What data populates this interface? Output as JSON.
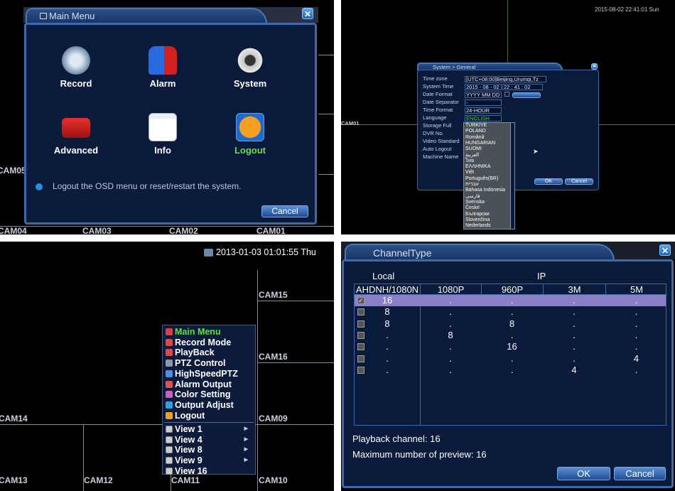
{
  "main_menu_screen": {
    "title": "Main Menu",
    "items": [
      {
        "label": "Record",
        "icon": "film-reel-icon"
      },
      {
        "label": "Alarm",
        "icon": "siren-icon"
      },
      {
        "label": "System",
        "icon": "gear-icon"
      },
      {
        "label": "Advanced",
        "icon": "toolbox-icon"
      },
      {
        "label": "Info",
        "icon": "info-window-icon"
      },
      {
        "label": "Logout",
        "icon": "power-icon",
        "selected": true
      }
    ],
    "hint": "Logout the OSD menu or reset/restart the system.",
    "cancel_label": "Cancel",
    "cameras": [
      "CAM05",
      "CAM04",
      "CAM03",
      "CAM02",
      "CAM01"
    ]
  },
  "general_screen": {
    "timestamp": "2015-08-02 22:41:01 Sun",
    "camera": "CAM01",
    "title": "System > General",
    "fields": {
      "time_zone": {
        "label": "Time zone",
        "value": "[UTC+08:00]Beijing,Urumqi,Tz"
      },
      "system_time": {
        "label": "System Time",
        "value": "2015 - 08 - 02",
        "time": "22 : 41 : 02"
      },
      "date_format": {
        "label": "Date Format",
        "value": "YYYY MM DD"
      },
      "date_separator": {
        "label": "Date Separator",
        "value": "-"
      },
      "time_format": {
        "label": "Time Format",
        "value": "24-HOUR"
      },
      "language": {
        "label": "Language",
        "value": "ENGLISH"
      },
      "storage_full": {
        "label": "Storage Full"
      },
      "dvr_no": {
        "label": "DVR No."
      },
      "video_standard": {
        "label": "Video Standard"
      },
      "auto_logout": {
        "label": "Auto Logout"
      },
      "machine_name": {
        "label": "Machine Name"
      }
    },
    "language_options": [
      "TURKIYE",
      "POLAND",
      "Română",
      "HUNGARIAN",
      "SUOMI",
      "العربية",
      "ไทย",
      "ΕΛΛΗΝΙΚΑ",
      "Việt",
      "Português(BR)",
      "עברית",
      "Bahasa Indonesia",
      "فارسی",
      "Svenska",
      "České",
      "Български",
      "Slovenčina",
      "Nederlands"
    ],
    "ok_label": "OK",
    "cancel_label": "Cancel"
  },
  "context_menu_screen": {
    "timestamp": "2013-01-03 01:01:55 Thu",
    "cameras": [
      "CAM15",
      "CAM16",
      "CAM14",
      "CAM09",
      "CAM13",
      "CAM12",
      "CAM11",
      "CAM10"
    ],
    "menu": [
      {
        "label": "Main Menu",
        "icon": "main-menu-icon",
        "color": "#d84040",
        "highlighted": true
      },
      {
        "label": "Record Mode",
        "icon": "record-mode-icon",
        "color": "#e04848"
      },
      {
        "label": "PlayBack",
        "icon": "playback-icon",
        "color": "#e04848"
      },
      {
        "label": "PTZ Control",
        "icon": "ptz-camera-icon",
        "color": "#8899aa"
      },
      {
        "label": "HighSpeedPTZ",
        "icon": "diamond-icon",
        "color": "#4a90e0"
      },
      {
        "label": "Alarm Output",
        "icon": "alarm-output-icon",
        "color": "#e05050"
      },
      {
        "label": "Color Setting",
        "icon": "color-grid-icon",
        "color": "#c060c0"
      },
      {
        "label": "Output Adjust",
        "icon": "monitor-icon",
        "color": "#30a0e0"
      },
      {
        "label": "Logout",
        "icon": "logout-icon",
        "color": "#f0a020"
      }
    ],
    "views": [
      {
        "label": "View 1",
        "submenu": true
      },
      {
        "label": "View 4",
        "submenu": true
      },
      {
        "label": "View 8",
        "submenu": true
      },
      {
        "label": "View 9",
        "submenu": true
      },
      {
        "label": "View 16",
        "submenu": false
      }
    ]
  },
  "channel_type_screen": {
    "title": "ChannelType",
    "group_local": "Local",
    "group_ip": "IP",
    "columns": [
      "AHDNH/1080N",
      "1080P",
      "960P",
      "3M",
      "5M"
    ],
    "rows": [
      {
        "checked": true,
        "values": [
          "16",
          ".",
          ".",
          ".",
          "."
        ]
      },
      {
        "checked": false,
        "values": [
          "8",
          ".",
          ".",
          ".",
          "."
        ]
      },
      {
        "checked": false,
        "values": [
          "8",
          ".",
          "8",
          ".",
          "."
        ]
      },
      {
        "checked": false,
        "values": [
          ".",
          "8",
          ".",
          ".",
          "."
        ]
      },
      {
        "checked": false,
        "values": [
          ".",
          ".",
          "16",
          ".",
          "."
        ]
      },
      {
        "checked": false,
        "values": [
          ".",
          ".",
          ".",
          ".",
          "4"
        ]
      },
      {
        "checked": false,
        "values": [
          ".",
          ".",
          ".",
          "4",
          "."
        ]
      }
    ],
    "playback_channel": "Playback channel: 16",
    "max_preview": "Maximum number of preview: 16",
    "ok_label": "OK",
    "cancel_label": "Cancel",
    "accent": "#8a80c8"
  }
}
